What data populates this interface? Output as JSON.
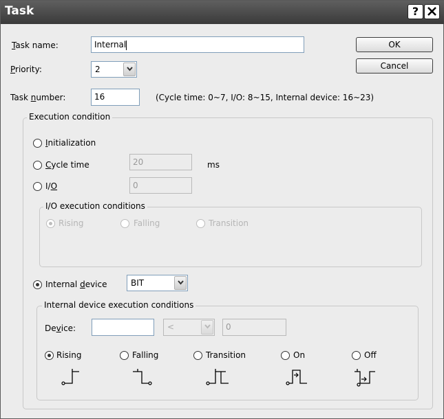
{
  "window": {
    "title": "Task",
    "help": "?",
    "close": "X"
  },
  "task_name": {
    "label_key": "T",
    "label_rest": "ask name:",
    "value": "Internal"
  },
  "priority": {
    "label_key": "P",
    "label_rest": "riority:",
    "value": "2"
  },
  "task_number": {
    "label_pre": "Task ",
    "label_key": "n",
    "label_rest": "umber:",
    "value": "16",
    "hint": "(Cycle time: 0~7, I/O: 8~15, Internal device: 16~23)"
  },
  "buttons": {
    "ok": "OK",
    "cancel": "Cancel"
  },
  "execution": {
    "group_title": "Execution condition",
    "initialization": {
      "key": "I",
      "rest": "nitialization"
    },
    "cycle_time": {
      "key": "C",
      "rest": "ycle time",
      "value": "20",
      "unit": "ms"
    },
    "io": {
      "pre": "I/",
      "key": "O",
      "value": "0"
    },
    "io_conditions": {
      "title": "I/O execution conditions",
      "rising": "Rising",
      "falling": "Falling",
      "transition": "Transition"
    },
    "internal_device": {
      "pre": "Internal ",
      "key": "d",
      "rest": "evice",
      "type": "BIT"
    }
  },
  "internal_conditions": {
    "title": "Internal device execution conditions",
    "device_label_pre": "De",
    "device_label_key": "v",
    "device_label_rest": "ice:",
    "device_value": "",
    "operator": "<",
    "compare_value": "0",
    "options": [
      "Rising",
      "Falling",
      "Transition",
      "On",
      "Off"
    ],
    "selected": "Rising"
  }
}
